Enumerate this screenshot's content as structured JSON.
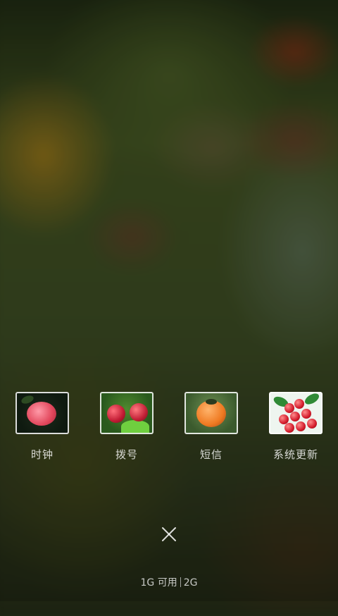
{
  "recent_apps": [
    {
      "label": "时钟",
      "thumbnail": "red-apple-photo"
    },
    {
      "label": "拨号",
      "thumbnail": "plums-on-tree-photo"
    },
    {
      "label": "短信",
      "thumbnail": "persimmon-photo"
    },
    {
      "label": "系统更新",
      "thumbnail": "cherries-photo"
    }
  ],
  "close_all": {
    "icon": "close-icon"
  },
  "memory": {
    "available": "1G 可用",
    "total": "2G"
  }
}
